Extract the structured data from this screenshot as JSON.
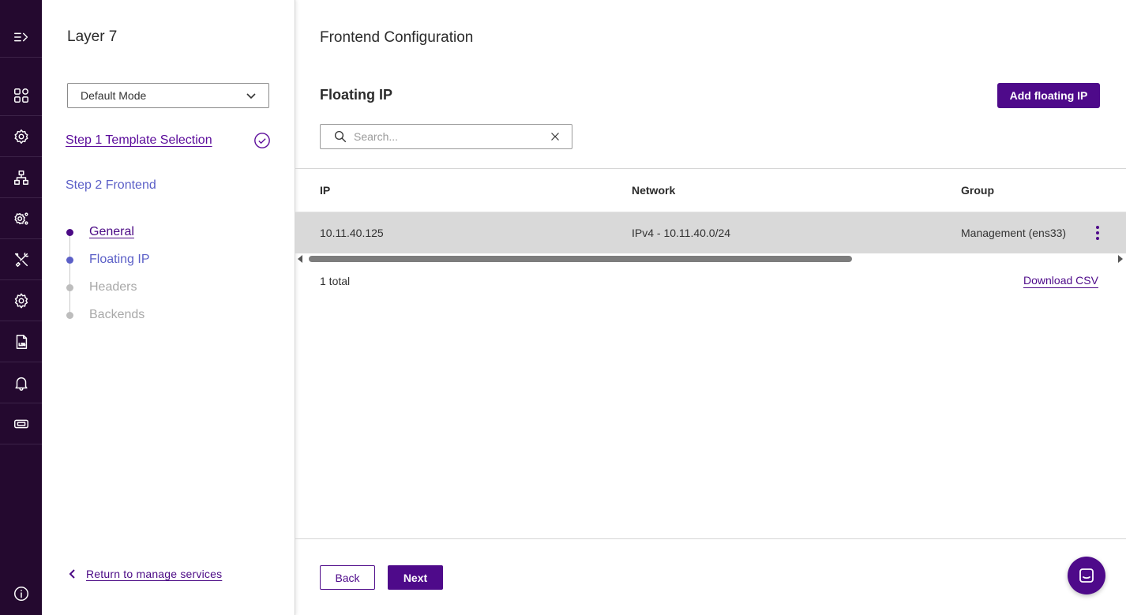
{
  "sidebar_rail": {
    "items": [
      {
        "icon": "menu-expand-icon"
      },
      {
        "icon": "dashboard-icon"
      },
      {
        "icon": "cog-cloud-icon"
      },
      {
        "icon": "network-icon"
      },
      {
        "icon": "settings-advanced-icon"
      },
      {
        "icon": "tools-icon"
      },
      {
        "icon": "gear-icon"
      },
      {
        "icon": "log-file-icon"
      },
      {
        "icon": "bell-icon"
      },
      {
        "icon": "ticket-icon"
      },
      {
        "icon": "info-icon"
      }
    ]
  },
  "wizard": {
    "title": "Layer 7",
    "mode_select": {
      "value": "Default Mode"
    },
    "step1": "Step 1 Template Selection",
    "step2": "Step 2 Frontend",
    "substeps": [
      "General",
      "Floating IP",
      "Headers",
      "Backends"
    ],
    "return_link": "Return to manage services"
  },
  "main": {
    "title": "Frontend Configuration",
    "section_title": "Floating IP",
    "add_button": "Add floating IP",
    "search": {
      "placeholder": "Search...",
      "value": ""
    },
    "table": {
      "headers": [
        "IP",
        "Network",
        "Group"
      ],
      "rows": [
        {
          "ip": "10.11.40.125",
          "network": "IPv4 - 10.11.40.0/24",
          "group": "Management (ens33)"
        }
      ]
    },
    "total": "1 total",
    "download_csv": "Download CSV"
  },
  "footer": {
    "back": "Back",
    "next": "Next"
  },
  "colors": {
    "rail": "#24092f",
    "primary": "#4e0a8a",
    "active_step": "#5b5fc7",
    "row_selected": "#d9d9d9"
  }
}
